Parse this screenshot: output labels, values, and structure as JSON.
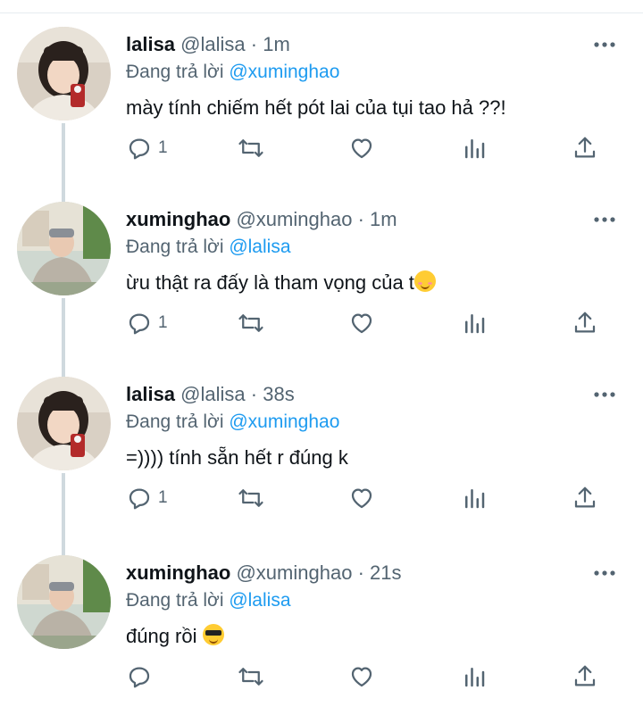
{
  "colors": {
    "link": "#1d9bf0",
    "muted": "#536471",
    "text": "#0f1419",
    "thread_line": "#cfd9de"
  },
  "reply_prefix": "Đang trả lời",
  "tweets": [
    {
      "name": "lalisa",
      "handle": "@lalisa",
      "dot": "·",
      "time": "1m",
      "reply_to": "@xuminghao",
      "text": "mày tính chiếm hết pót lai của tụi tao hả ??!",
      "emoji": null,
      "reply_count": "1",
      "avatar": "lalisa-avatar"
    },
    {
      "name": "xuminghao",
      "handle": "@xuminghao",
      "dot": "·",
      "time": "1m",
      "reply_to": "@lalisa",
      "text": "ừu thật ra đấy là tham vọng của t",
      "emoji": "smiling-blush-emoji",
      "reply_count": "1",
      "avatar": "xuminghao-avatar"
    },
    {
      "name": "lalisa",
      "handle": "@lalisa",
      "dot": "·",
      "time": "38s",
      "reply_to": "@xuminghao",
      "text": "=)))) tính sẵn hết r đúng k",
      "emoji": null,
      "reply_count": "1",
      "avatar": "lalisa-avatar"
    },
    {
      "name": "xuminghao",
      "handle": "@xuminghao",
      "dot": "·",
      "time": "21s",
      "reply_to": "@lalisa",
      "text": "đúng rồi",
      "emoji": "sunglasses-emoji",
      "reply_count": "",
      "avatar": "xuminghao-avatar"
    }
  ]
}
